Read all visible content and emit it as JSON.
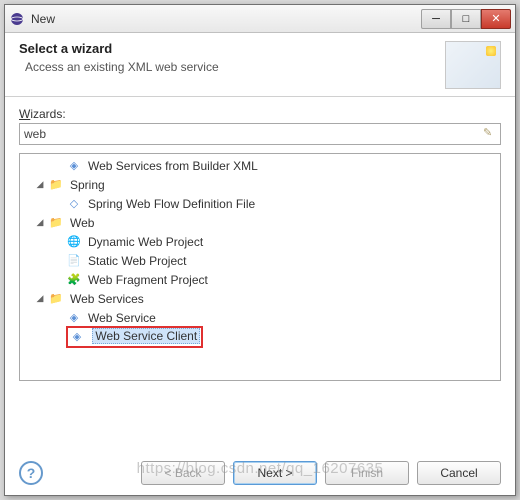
{
  "window": {
    "title": "New"
  },
  "header": {
    "title": "Select a wizard",
    "subtitle": "Access an existing XML web service"
  },
  "wizards_label": "Wizards:",
  "filter_value": "web",
  "tree": {
    "item0": "Web Services from Builder XML",
    "spring": "Spring",
    "spring_flow": "Spring Web Flow Definition File",
    "web": "Web",
    "web_dyn": "Dynamic Web Project",
    "web_static": "Static Web Project",
    "web_frag": "Web Fragment Project",
    "ws": "Web Services",
    "ws_service": "Web Service",
    "ws_client": "Web Service Client"
  },
  "buttons": {
    "back": "< Back",
    "next": "Next >",
    "finish": "Finish",
    "cancel": "Cancel"
  },
  "watermark": "https://blog.csdn.net/qq_16207635"
}
